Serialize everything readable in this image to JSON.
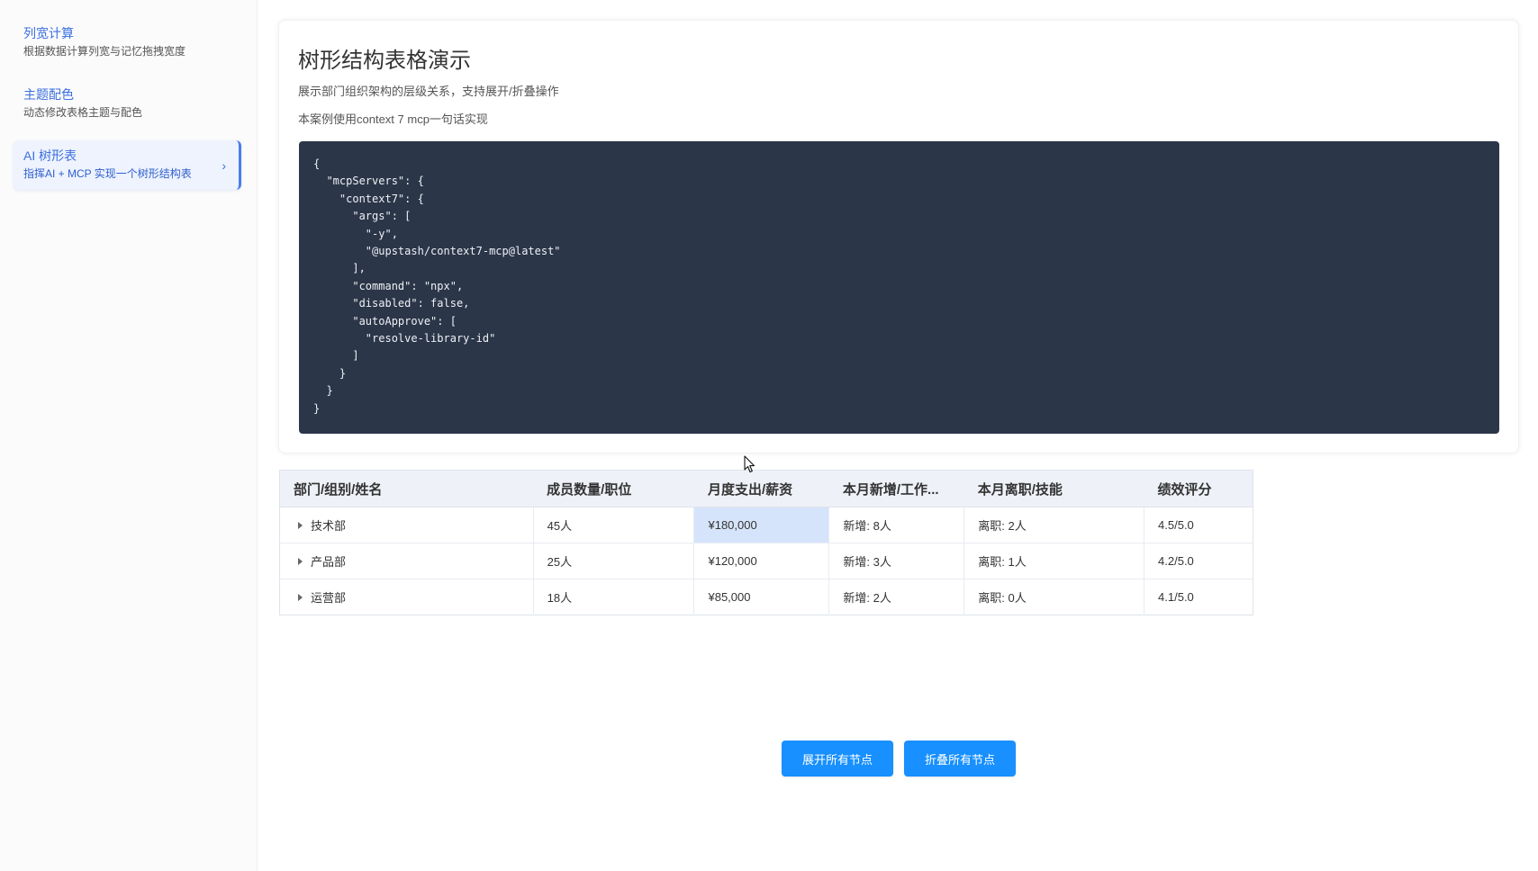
{
  "sidebar": {
    "items": [
      {
        "title": "列宽计算",
        "desc": "根据数据计算列宽与记忆拖拽宽度"
      },
      {
        "title": "主题配色",
        "desc": "动态修改表格主题与配色"
      },
      {
        "title": "AI 树形表",
        "desc": "指挥AI + MCP 实现一个树形结构表",
        "active": true
      }
    ],
    "chevron": "›"
  },
  "card": {
    "title": "树形结构表格演示",
    "desc": "展示部门组织架构的层级关系，支持展开/折叠操作",
    "note": "本案例使用context 7 mcp一句话实现",
    "code": "{\n  \"mcpServers\": {\n    \"context7\": {\n      \"args\": [\n        \"-y\",\n        \"@upstash/context7-mcp@latest\"\n      ],\n      \"command\": \"npx\",\n      \"disabled\": false,\n      \"autoApprove\": [\n        \"resolve-library-id\"\n      ]\n    }\n  }\n}"
  },
  "table": {
    "headers": [
      "部门/组别/姓名",
      "成员数量/职位",
      "月度支出/薪资",
      "本月新增/工作...",
      "本月离职/技能",
      "绩效评分"
    ],
    "rows": [
      [
        "技术部",
        "45人",
        "¥180,000",
        "新增: 8人",
        "离职: 2人",
        "4.5/5.0"
      ],
      [
        "产品部",
        "25人",
        "¥120,000",
        "新增: 3人",
        "离职: 1人",
        "4.2/5.0"
      ],
      [
        "运营部",
        "18人",
        "¥85,000",
        "新增: 2人",
        "离职: 0人",
        "4.1/5.0"
      ]
    ]
  },
  "actions": {
    "expand_all": "展开所有节点",
    "collapse_all": "折叠所有节点"
  },
  "colors": {
    "primary": "#1890ff",
    "code_bg": "#2b3648",
    "link": "#3b6fe0",
    "highlight_cell": "#d6e4fb"
  },
  "icons": {
    "tree_toggle": "caret-right-icon",
    "nav_chevron": "chevron-right-icon",
    "pointer": "mouse-cursor-icon"
  }
}
